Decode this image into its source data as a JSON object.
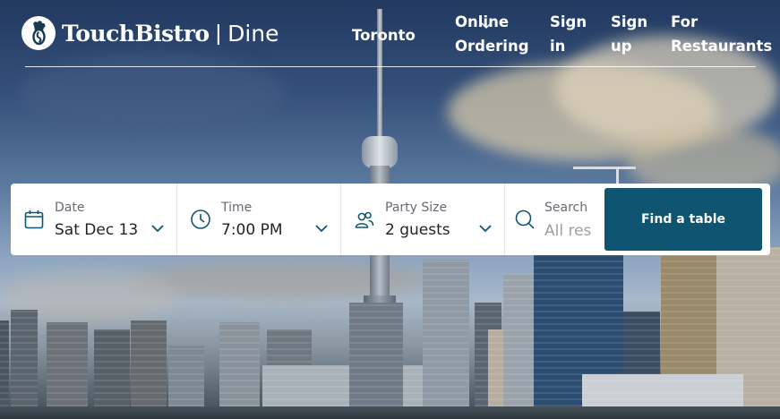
{
  "brand": {
    "name": "TouchBistro",
    "separator": "|",
    "product": "Dine",
    "logo_icon": "chef-logo-icon"
  },
  "nav": {
    "city": "Toronto",
    "online_ordering": "Online\nOrdering",
    "sign_in": "Sign\nin",
    "sign_up": "Sign\nup",
    "for_restaurants": "For\nRestaurants"
  },
  "search": {
    "date": {
      "label": "Date",
      "value": "Sat Dec 13",
      "icon": "calendar-icon"
    },
    "time": {
      "label": "Time",
      "value": "7:00 PM",
      "icon": "clock-icon"
    },
    "party": {
      "label": "Party Size",
      "value": "2 guests",
      "icon": "people-icon"
    },
    "query": {
      "label": "Search",
      "placeholder": "All res",
      "icon": "search-icon"
    },
    "submit_label": "Find a table"
  },
  "colors": {
    "button_bg": "#0f5470",
    "text_dark": "#1f2328",
    "label_gray": "#666b73",
    "header_text": "#ffffff"
  }
}
